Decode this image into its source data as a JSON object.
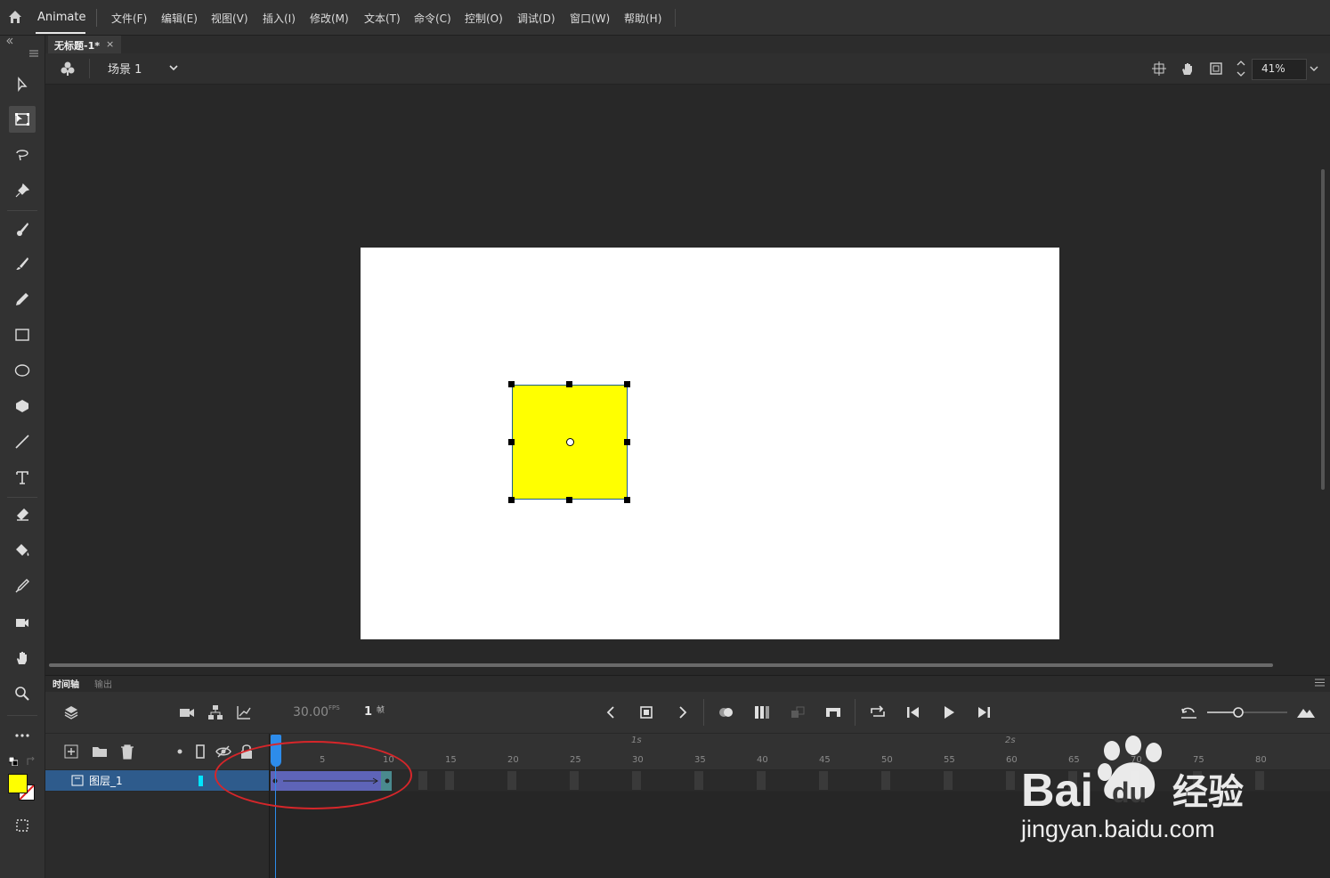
{
  "app": {
    "name": "Animate"
  },
  "menu": [
    "文件(F)",
    "编辑(E)",
    "视图(V)",
    "插入(I)",
    "修改(M)",
    "文本(T)",
    "命令(C)",
    "控制(O)",
    "调试(D)",
    "窗口(W)",
    "帮助(H)"
  ],
  "document": {
    "tab_title": "无标题-1*",
    "close": "×"
  },
  "scene": {
    "label": "场景 1",
    "zoom": "41%"
  },
  "timeline": {
    "tabs": [
      "时间轴",
      "输出"
    ],
    "fps": "30.00",
    "fps_unit": "FPS",
    "current_frame": "1",
    "frame_unit": "帧",
    "layer_name": "图层_1",
    "ruler_ticks": [
      "5",
      "10",
      "15",
      "20",
      "25",
      "30",
      "35",
      "40",
      "45",
      "50",
      "55",
      "60",
      "65",
      "70",
      "75",
      "80"
    ],
    "ruler_seconds": [
      "1s",
      "2s"
    ],
    "tween_frames": [
      1,
      10
    ]
  },
  "colors": {
    "fill": "#ffff00",
    "tween": "#5e64b8",
    "playhead": "#2d8ceb",
    "highlight_ellipse": "#d6262a"
  },
  "watermark": {
    "logo": "Bai du 经验",
    "url": "jingyan.baidu.com"
  }
}
